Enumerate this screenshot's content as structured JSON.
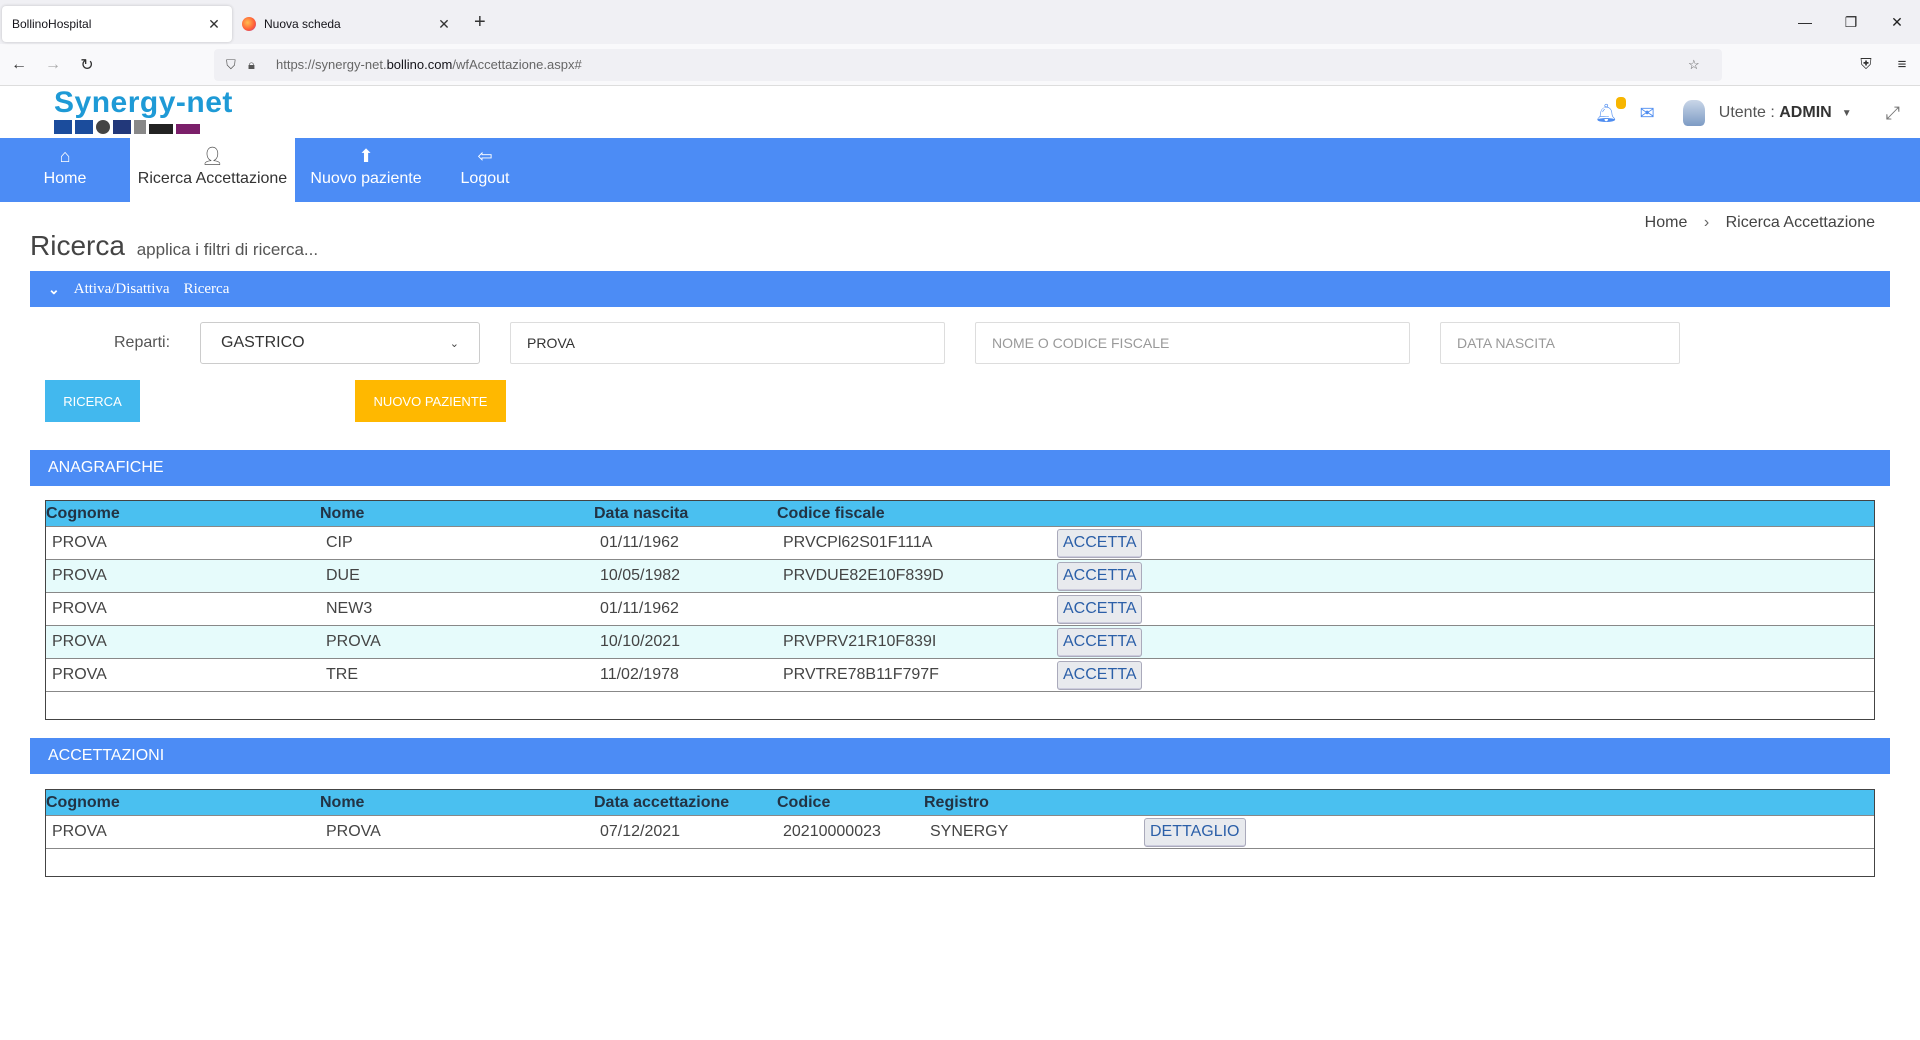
{
  "browser": {
    "tabs": [
      {
        "title": "BollinoHospital",
        "active": true
      },
      {
        "title": "Nuova scheda",
        "active": false
      }
    ],
    "url_prefix": "https://synergy-net.",
    "url_domain": "bollino.com",
    "url_suffix": "/wfAccettazione.aspx#"
  },
  "header": {
    "logo": "Synergy-net",
    "user_label": "Utente : ",
    "user_name": "ADMIN"
  },
  "mainnav": {
    "items": [
      {
        "label": "Home",
        "icon": "home-icon"
      },
      {
        "label": "Ricerca Accettazione",
        "icon": "user-search-icon",
        "active": true
      },
      {
        "label": "Nuovo paziente",
        "icon": "user-add-icon"
      },
      {
        "label": "Logout",
        "icon": "logout-icon"
      }
    ]
  },
  "breadcrumb": {
    "home": "Home",
    "current": "Ricerca Accettazione"
  },
  "page": {
    "title": "Ricerca",
    "subtitle": "applica i filtri di ricerca..."
  },
  "toggle": {
    "label1": "Attiva/Disattiva",
    "label2": "Ricerca"
  },
  "filters": {
    "reparti_label": "Reparti:",
    "reparti_value": "GASTRICO",
    "cognome_value": "PROVA",
    "nome_placeholder": "NOME O CODICE FISCALE",
    "data_placeholder": "DATA NASCITA",
    "ricerca_button": "RICERCA",
    "nuovo_button": "NUOVO PAZIENTE"
  },
  "anagrafiche": {
    "title": "ANAGRAFICHE",
    "headers": [
      "Cognome",
      "Nome",
      "Data nascita",
      "Codice fiscale"
    ],
    "action_label": "ACCETTA",
    "rows": [
      {
        "cognome": "PROVA",
        "nome": "CIP",
        "data": "01/11/1962",
        "cf": "PRVCPl62S01F111A"
      },
      {
        "cognome": "PROVA",
        "nome": "DUE",
        "data": "10/05/1982",
        "cf": "PRVDUE82E10F839D"
      },
      {
        "cognome": "PROVA",
        "nome": "NEW3",
        "data": "01/11/1962",
        "cf": ""
      },
      {
        "cognome": "PROVA",
        "nome": "PROVA",
        "data": "10/10/2021",
        "cf": "PRVPRV21R10F839I"
      },
      {
        "cognome": "PROVA",
        "nome": "TRE",
        "data": "11/02/1978",
        "cf": "PRVTRE78B11F797F"
      }
    ]
  },
  "accettazioni": {
    "title": "ACCETTAZIONI",
    "headers": [
      "Cognome",
      "Nome",
      "Data accettazione",
      "Codice",
      "Registro"
    ],
    "action_label": "DETTAGLIO",
    "rows": [
      {
        "cognome": "PROVA",
        "nome": "PROVA",
        "data": "07/12/2021",
        "codice": "20210000023",
        "registro": "SYNERGY"
      }
    ]
  },
  "colors": {
    "primary": "#4c8cf5",
    "table_header": "#4ac0f0",
    "accent_yellow": "#ffb800",
    "accent_blue": "#42b8ee"
  }
}
